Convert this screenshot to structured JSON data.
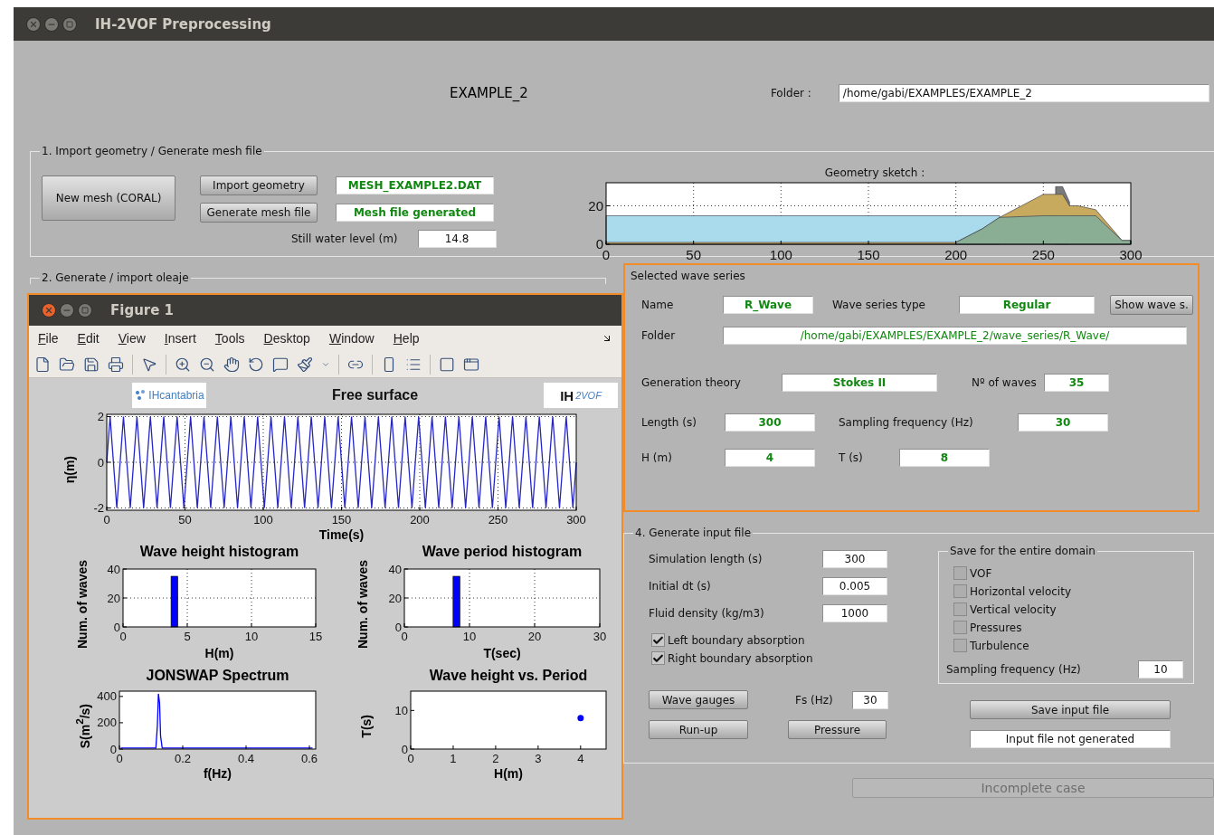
{
  "window": {
    "title": "IH-2VOF Preprocessing"
  },
  "header": {
    "case_name": "EXAMPLE_2",
    "folder_label": "Folder :",
    "folder": "/home/gabi/EXAMPLES/EXAMPLE_2"
  },
  "section_1": {
    "title": "1. Import geometry / Generate mesh file",
    "new_mesh_button": "New mesh (CORAL)",
    "rows": [
      {
        "button": "Import geometry",
        "value": "MESH_EXAMPLE2.DAT",
        "kind": "result"
      },
      {
        "button": "Generate mesh file",
        "value": "Mesh file generated",
        "kind": "result"
      }
    ],
    "still_water": {
      "label": "Still water level (m)",
      "value": "14.8",
      "kind": "plain"
    },
    "sketch": {
      "chart_data": {
        "type": "area",
        "title": "Geometry sketch :",
        "x": [
          0,
          200,
          215,
          225,
          250,
          257,
          261,
          265,
          270,
          280,
          295,
          300
        ],
        "series": [
          {
            "color": "#a9dbed",
            "values": [
              14.8,
              14.8,
              14.8,
              14.8,
              null,
              null,
              null,
              null,
              null,
              null,
              null,
              null
            ]
          },
          {
            "color": "#7a7a7a",
            "values": [
              null,
              null,
              null,
              null,
              null,
              30,
              30,
              22,
              null,
              null,
              null,
              null
            ]
          },
          {
            "color": "#c8aa5f",
            "values": [
              1,
              1,
              8,
              14,
              26,
              26,
              26,
              20,
              20,
              18,
              2,
              2
            ]
          },
          {
            "color": "#8aae94",
            "values": [
              null,
              1,
              8,
              14,
              14.8,
              14.8,
              14.8,
              14.8,
              14.8,
              14.8,
              2,
              2
            ]
          }
        ],
        "xlim": [
          0,
          300
        ],
        "ylim": [
          0,
          32
        ],
        "xticks": [
          0,
          50,
          100,
          150,
          200,
          250,
          300
        ],
        "yticks": [
          0,
          20
        ],
        "grid": true
      }
    }
  },
  "section_2": {
    "title": "2. Generate / import oleaje"
  },
  "figure": {
    "title": "Figure 1",
    "menu": [
      "File",
      "Edit",
      "View",
      "Insert",
      "Tools",
      "Desktop",
      "Window",
      "Help"
    ],
    "logo_left": "IHcantabria",
    "logo_right": [
      "IH",
      "2VOF"
    ],
    "plots": [
      {
        "chart_data": {
          "type": "line",
          "title": "Free surface",
          "xlabel": "Time(s)",
          "ylabel": "η(m)",
          "x": [
            0,
            2.14,
            4.29,
            6.43,
            8.57,
            10.71,
            12.86,
            15,
            17.14,
            19.29,
            21.43,
            23.57,
            25.71,
            27.86,
            30,
            32.14,
            34.29,
            36.43,
            38.57,
            40.71,
            42.86,
            45,
            47.14,
            49.29,
            51.43,
            53.57,
            55.71,
            57.86,
            60,
            62.14,
            64.29,
            66.43,
            68.57,
            70.71,
            72.86,
            75,
            77.14,
            79.29,
            81.43,
            83.57,
            85.71,
            87.86,
            90,
            92.14,
            94.29,
            96.43,
            98.57,
            100.71,
            102.86,
            105,
            107.14,
            109.29,
            111.43,
            113.57,
            115.71,
            117.86,
            120,
            122.14,
            124.29,
            126.43,
            128.57,
            130.71,
            132.86,
            135,
            137.14,
            139.29,
            141.43,
            143.57,
            145.71,
            147.86,
            150,
            152.14,
            154.29,
            156.43,
            158.57,
            160.71,
            162.86,
            165,
            167.14,
            169.29,
            171.43,
            173.57,
            175.71,
            177.86,
            180,
            182.14,
            184.29,
            186.43,
            188.57,
            190.71,
            192.86,
            195,
            197.14,
            199.29,
            201.43,
            203.57,
            205.71,
            207.86,
            210,
            212.14,
            214.29,
            216.43,
            218.57,
            220.71,
            222.86,
            225,
            227.14,
            229.29,
            231.43,
            233.57,
            235.71,
            237.86,
            240,
            242.14,
            244.29,
            246.43,
            248.57,
            250.71,
            252.86,
            255,
            257.14,
            259.29,
            261.43,
            263.57,
            265.71,
            267.86,
            270,
            272.14,
            274.29,
            276.43,
            278.57,
            280.71,
            282.86,
            285,
            287.14,
            289.29,
            291.43,
            293.57,
            295.71,
            297.86,
            300
          ],
          "series": [
            {
              "color": "#2626c4",
              "values": [
                0,
                2,
                0,
                -2,
                0,
                2,
                0,
                -2,
                0,
                2,
                0,
                -2,
                0,
                2,
                0,
                -2,
                0,
                2,
                0,
                -2,
                0,
                2,
                0,
                -2,
                0,
                2,
                0,
                -2,
                0,
                2,
                0,
                -2,
                0,
                2,
                0,
                -2,
                0,
                2,
                0,
                -2,
                0,
                2,
                0,
                -2,
                0,
                2,
                0,
                -2,
                0,
                2,
                0,
                -2,
                0,
                2,
                0,
                -2,
                0,
                2,
                0,
                -2,
                0,
                2,
                0,
                -2,
                0,
                2,
                0,
                -2,
                0,
                2,
                0,
                -2,
                0,
                2,
                0,
                -2,
                0,
                2,
                0,
                -2,
                0,
                2,
                0,
                -2,
                0,
                2,
                0,
                -2,
                0,
                2,
                0,
                -2,
                0,
                2,
                0,
                -2,
                0,
                2,
                0,
                -2,
                0,
                2,
                0,
                -2,
                0,
                2,
                0,
                -2,
                0,
                2,
                0,
                -2,
                0,
                2,
                0,
                -2,
                0,
                2,
                0,
                -2,
                0,
                2,
                0,
                -2,
                0,
                2,
                0,
                -2,
                0,
                2,
                0,
                -2,
                0,
                2,
                0,
                -2,
                0,
                2,
                0,
                -2,
                0
              ]
            }
          ],
          "xlim": [
            0,
            300
          ],
          "ylim": [
            -2.1,
            2.1
          ],
          "xticks": [
            0,
            50,
            100,
            150,
            200,
            250,
            300
          ],
          "yticks": [
            -2,
            0,
            2
          ],
          "grid": true
        }
      },
      {
        "chart_data": {
          "type": "bar",
          "title": "Wave height histogram",
          "xlabel": "H(m)",
          "ylabel": "Num. of waves",
          "x": [
            4
          ],
          "series": [
            {
              "color": "#0000ff",
              "values": [
                35
              ]
            }
          ],
          "xlim": [
            0,
            15
          ],
          "ylim": [
            0,
            40
          ],
          "xticks": [
            0,
            5,
            10,
            15
          ],
          "yticks": [
            0,
            20,
            40
          ],
          "grid": true
        }
      },
      {
        "chart_data": {
          "type": "bar",
          "title": "Wave period histogram",
          "xlabel": "T(sec)",
          "ylabel": "Num. of waves",
          "x": [
            8
          ],
          "series": [
            {
              "color": "#0000ff",
              "values": [
                35
              ]
            }
          ],
          "xlim": [
            0,
            30
          ],
          "ylim": [
            0,
            40
          ],
          "xticks": [
            0,
            10,
            20,
            30
          ],
          "yticks": [
            0,
            20,
            40
          ],
          "grid": true
        }
      },
      {
        "chart_data": {
          "type": "line",
          "title": "JONSWAP Spectrum",
          "xlabel": "f(Hz)",
          "ylabel": "S(m$^{2}$/s)",
          "x": [
            0.004,
            0.115,
            0.12,
            0.123,
            0.127,
            0.13,
            0.135,
            0.61
          ],
          "series": [
            {
              "color": "#0000ff",
              "values": [
                8,
                8,
                180,
                420,
                350,
                100,
                8,
                8
              ]
            }
          ],
          "xlim": [
            0,
            0.62
          ],
          "ylim": [
            0,
            440
          ],
          "xticks": [
            0,
            0.2,
            0.4,
            0.6
          ],
          "yticks": [
            0,
            200,
            400
          ],
          "grid": false
        }
      },
      {
        "chart_data": {
          "type": "scatter",
          "title": "Wave height vs. Period",
          "xlabel": "H(m)",
          "ylabel": "T(s)",
          "x": [
            4
          ],
          "series": [
            {
              "color": "#0000ff",
              "values": [
                8
              ]
            }
          ],
          "xlim": [
            0,
            4.6
          ],
          "ylim": [
            0,
            15
          ],
          "xticks": [
            0,
            1,
            2,
            3,
            4
          ],
          "yticks": [
            0,
            10
          ],
          "grid": false
        }
      }
    ]
  },
  "wave_series": {
    "title": "Selected wave series",
    "button": "Show wave s.",
    "rows": [
      [
        {
          "label": "Name",
          "value": "R_Wave",
          "kind": "result"
        },
        {
          "label": "Wave series type",
          "value": "Regular",
          "kind": "result"
        }
      ],
      [
        {
          "label": "Folder",
          "value": "/home/gabi/EXAMPLES/EXAMPLE_2/wave_series/R_Wave/",
          "kind": "path"
        }
      ],
      [
        {
          "label": "Generation theory",
          "value": "Stokes  II",
          "kind": "result"
        },
        {
          "label": "Nº of waves",
          "value": "35",
          "kind": "result"
        }
      ],
      [
        {
          "label": "Length (s)",
          "value": "300",
          "kind": "result"
        },
        {
          "label": "Sampling frequency (Hz)",
          "value": "30",
          "kind": "result"
        }
      ],
      [
        {
          "label": "H (m)",
          "value": "4",
          "kind": "result"
        },
        {
          "label": "T (s)",
          "value": "8",
          "kind": "result"
        }
      ]
    ]
  },
  "section_4": {
    "title": "4. Generate input file",
    "fields": [
      {
        "label": "Simulation length (s)",
        "value": "300",
        "kind": "plain"
      },
      {
        "label": "Initial dt (s)",
        "value": "0.005",
        "kind": "plain"
      },
      {
        "label": "Fluid density (kg/m3)",
        "value": "1000",
        "kind": "plain"
      }
    ],
    "checkboxes": [
      {
        "label": "Left boundary absorption",
        "checked": true
      },
      {
        "label": "Right boundary absorption",
        "checked": true
      }
    ],
    "save_panel": {
      "title": "Save for the entire domain",
      "options": [
        {
          "label": "VOF",
          "checked": false
        },
        {
          "label": "Horizontal velocity",
          "checked": false
        },
        {
          "label": "Vertical velocity",
          "checked": false
        },
        {
          "label": "Pressures",
          "checked": false
        },
        {
          "label": "Turbulence",
          "checked": false
        }
      ],
      "sampling_label": "Sampling frequency (Hz)",
      "sampling_value": "10"
    },
    "wave_gauges_button": "Wave gauges",
    "fs_label": "Fs (Hz)",
    "fs_value": "30",
    "run_up_button": "Run-up",
    "pressure_button": "Pressure",
    "save_button": "Save input file",
    "file_status": "Input file not generated"
  },
  "status_button": {
    "label": "Incomplete case",
    "disabled": true
  }
}
